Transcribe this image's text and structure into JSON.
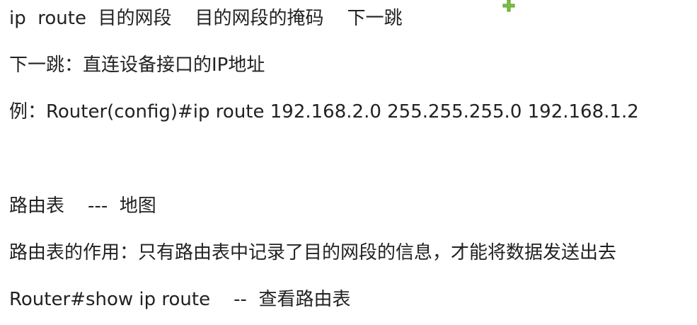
{
  "lines": [
    "ip  route  目的网段    目的网段的掩码    下一跳",
    "下一跳：直连设备接口的IP地址",
    "例：Router(config)#ip route 192.168.2.0 255.255.255.0 192.168.1.2",
    "路由表    ---  地图",
    "路由表的作用：只有路由表中记录了目的网段的信息，才能将数据发送出去",
    "Router#show ip route    --  查看路由表"
  ],
  "cursor_icon": "move-cursor-icon",
  "colors": {
    "text": "#222222",
    "cursor_green": "#7cc242"
  }
}
